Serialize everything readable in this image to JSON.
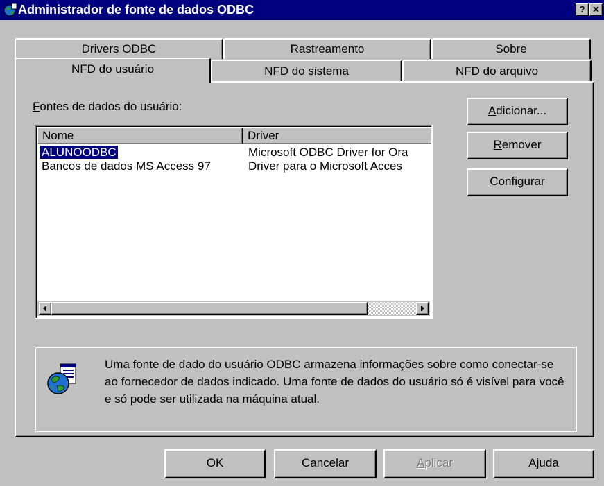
{
  "window": {
    "title": "Administrador de fonte de dados ODBC",
    "help_button": "?",
    "close_button": "✕"
  },
  "tabs": {
    "back_row": [
      "Drivers ODBC",
      "Rastreamento",
      "Sobre"
    ],
    "front_row": [
      "NFD do usuário",
      "NFD do sistema",
      "NFD do arquivo"
    ],
    "active": "NFD do usuário"
  },
  "panel": {
    "list_label_hotkey": "F",
    "list_label_rest": "ontes de dados do usuário:",
    "columns": [
      "Nome",
      "Driver"
    ],
    "rows": [
      {
        "name": "ALUNOODBC",
        "driver": "Microsoft ODBC Driver for Ora",
        "selected": true
      },
      {
        "name": "Bancos de dados MS Access 97",
        "driver": "Driver para o Microsoft Acces",
        "selected": false
      }
    ],
    "side_buttons": [
      {
        "pre": "",
        "hotkey": "A",
        "post": "dicionar..."
      },
      {
        "pre": "",
        "hotkey": "R",
        "post": "emover"
      },
      {
        "pre": "",
        "hotkey": "C",
        "post": "onfigurar"
      }
    ],
    "info_text": "Uma fonte de dado do usuário ODBC armazena informações sobre como conectar-se ao fornecedor de dados indicado. Uma fonte de dados do usuário só é visível para você e só pode ser utilizada na máquina atual."
  },
  "footer": {
    "ok": "OK",
    "cancel": "Cancelar",
    "apply_hotkey": "A",
    "apply_rest": "plicar",
    "help": "Ajuda"
  },
  "colors": {
    "titlebar": "#000080",
    "face": "#c0c0c0",
    "selection": "#000080"
  },
  "icons": {
    "title": "globe-database-icon",
    "info": "globe-document-icon"
  }
}
